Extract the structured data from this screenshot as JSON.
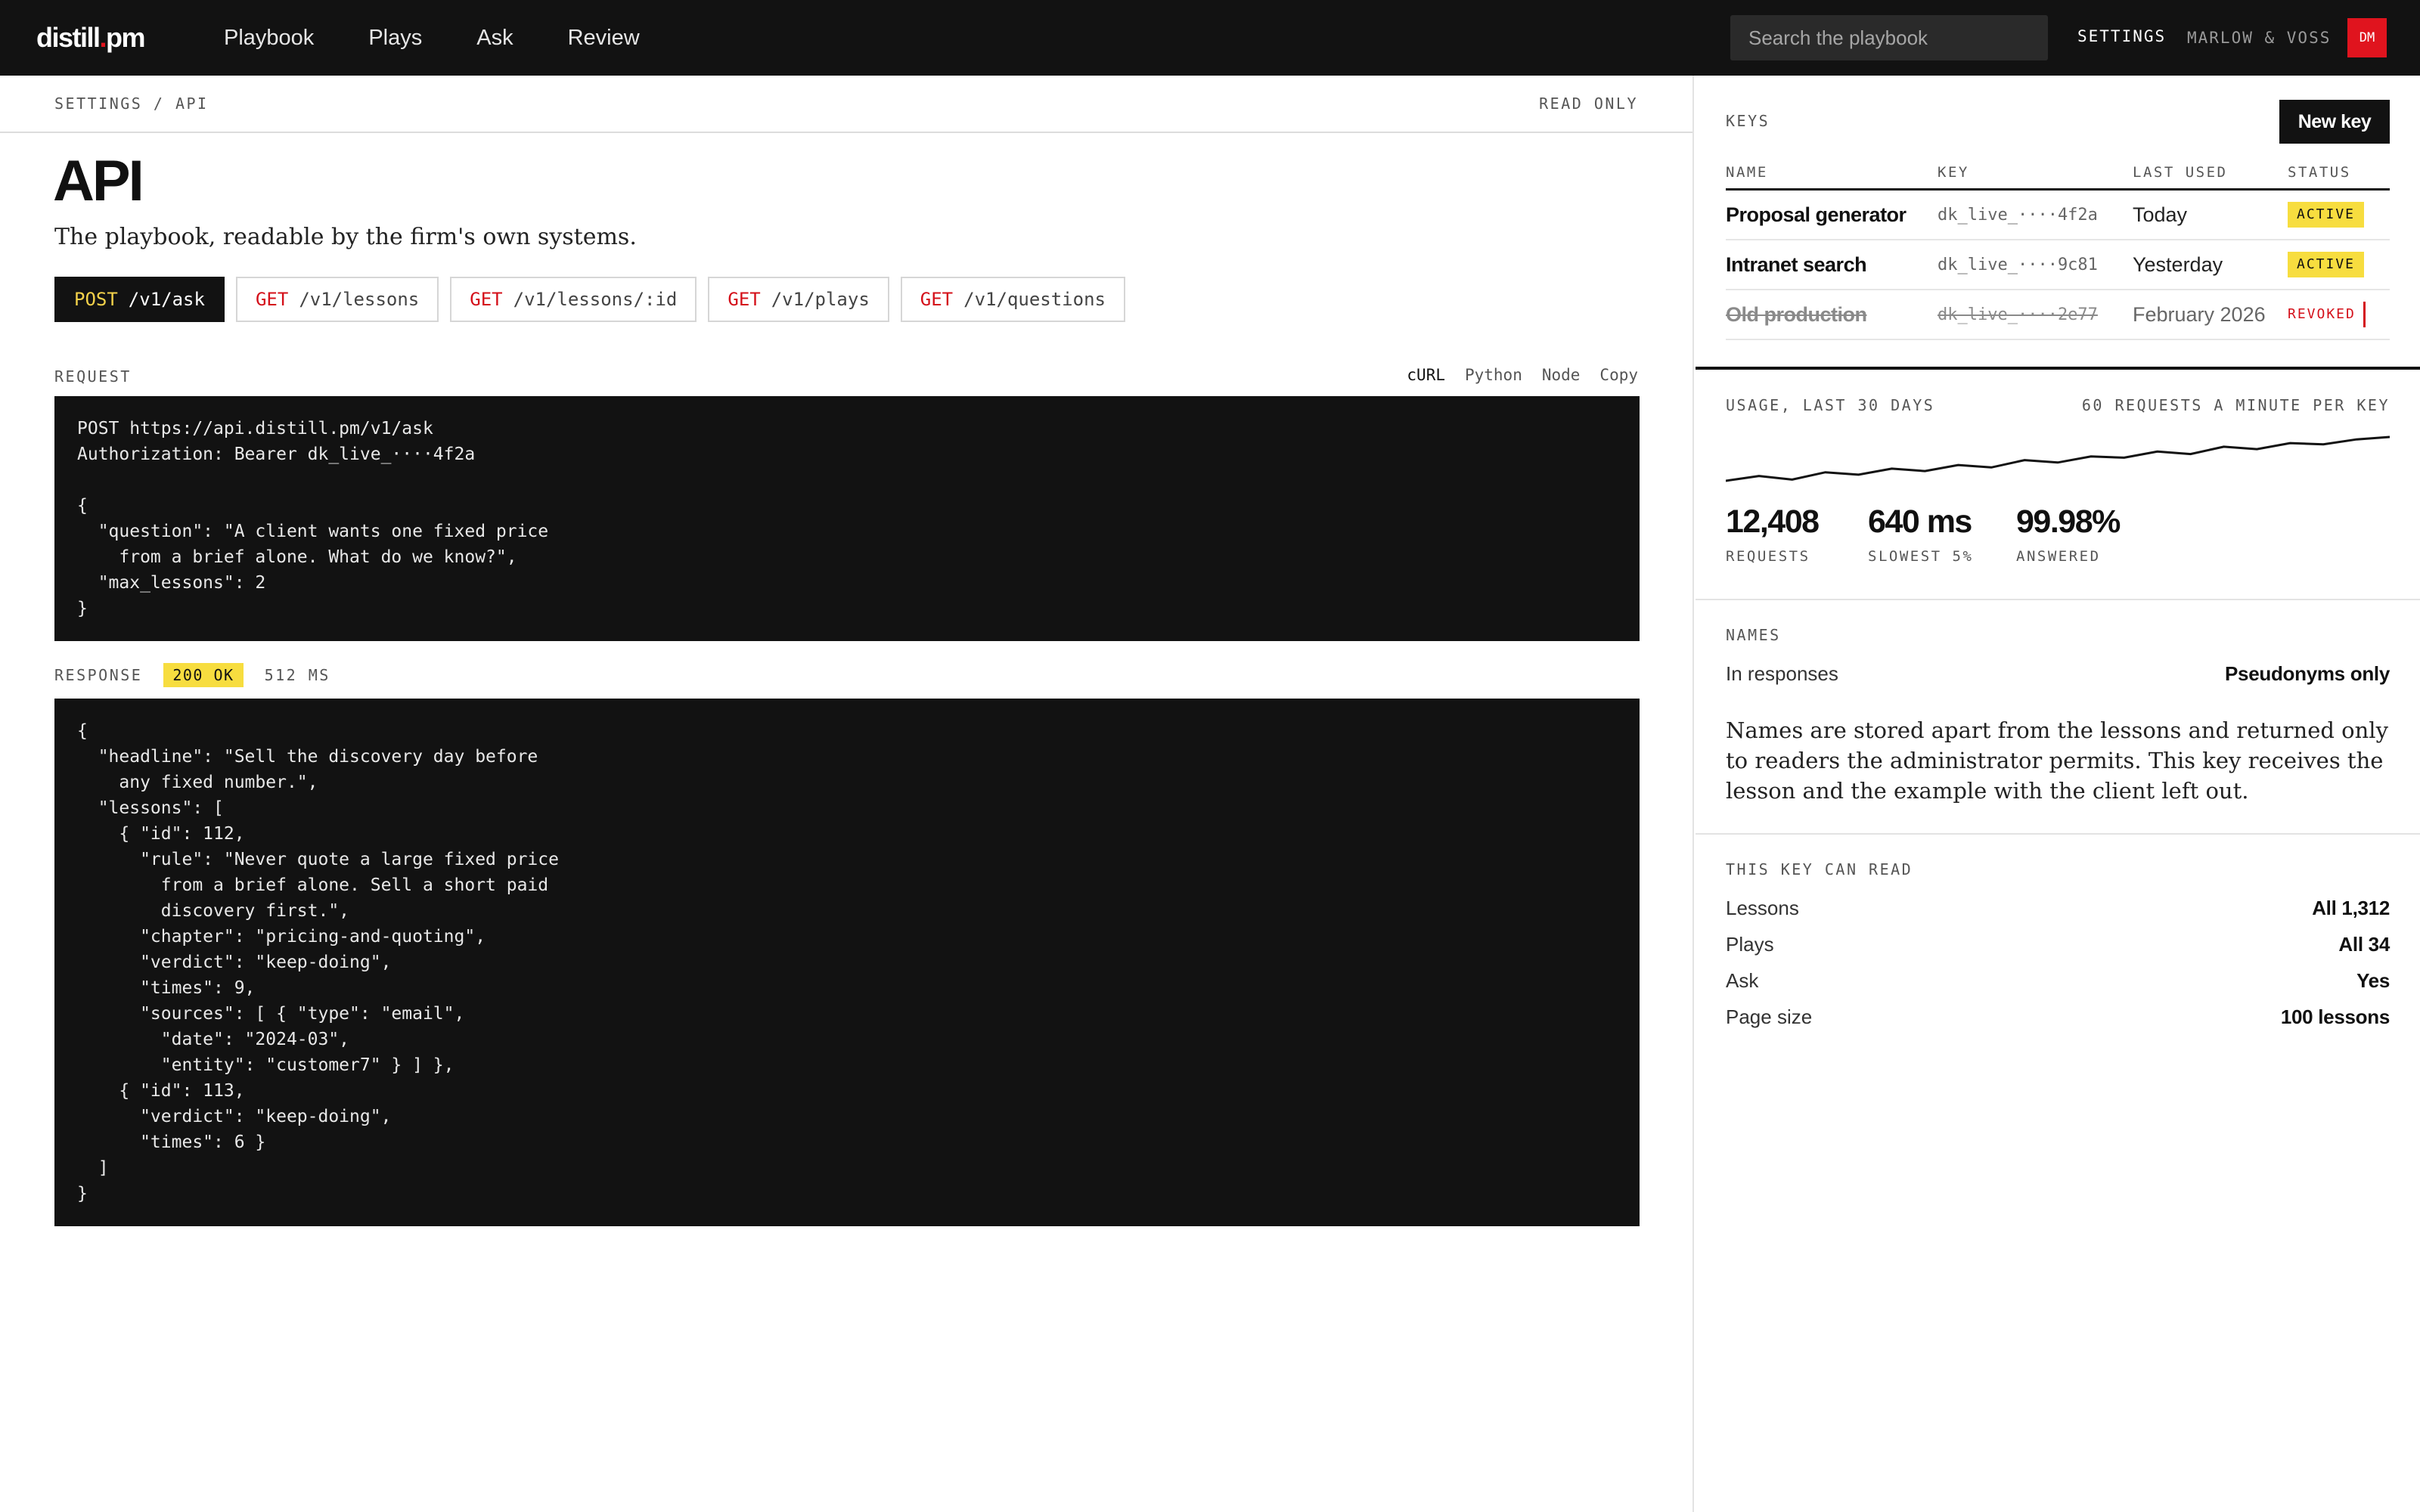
{
  "app": {
    "logo": "distill.pm",
    "nav": [
      "Playbook",
      "Plays",
      "Ask",
      "Review"
    ],
    "search_placeholder": "Search the playbook",
    "settings_label": "SETTINGS",
    "firm": "MARLOW & VOSS",
    "user_initials": "DM",
    "colors": {
      "accent_red": "#e0141e",
      "highlight_yellow": "#f7dd3f",
      "ink": "#121212"
    }
  },
  "page": {
    "breadcrumb": "SETTINGS / API",
    "mode": "READ ONLY",
    "title": "API",
    "subtitle": "The playbook, readable by the firm's own systems."
  },
  "endpoints": [
    {
      "method": "POST",
      "path": "/v1/ask",
      "selected": true
    },
    {
      "method": "GET",
      "path": "/v1/lessons"
    },
    {
      "method": "GET",
      "path": "/v1/lessons/:id"
    },
    {
      "method": "GET",
      "path": "/v1/plays"
    },
    {
      "method": "GET",
      "path": "/v1/questions"
    }
  ],
  "request": {
    "label": "REQUEST",
    "languages": [
      "cURL",
      "Python",
      "Node"
    ],
    "selected_language": "cURL",
    "copy_label": "Copy",
    "code": "POST https://api.distill.pm/v1/ask\nAuthorization: Bearer dk_live_····4f2a\n\n{\n  \"question\": \"A client wants one fixed price\n    from a brief alone. What do we know?\",\n  \"max_lessons\": 2\n}"
  },
  "response": {
    "label": "RESPONSE",
    "status": "200 OK",
    "time": "512 MS",
    "code": "{\n  \"headline\": \"Sell the discovery day before\n    any fixed number.\",\n  \"lessons\": [\n    { \"id\": 112,\n      \"rule\": \"Never quote a large fixed price\n        from a brief alone. Sell a short paid\n        discovery first.\",\n      \"chapter\": \"pricing-and-quoting\",\n      \"verdict\": \"keep-doing\",\n      \"times\": 9,\n      \"sources\": [ { \"type\": \"email\",\n        \"date\": \"2024-03\",\n        \"entity\": \"customer7\" } ] },\n    { \"id\": 113,\n      \"verdict\": \"keep-doing\",\n      \"times\": 6 }\n  ]\n}"
  },
  "keys": {
    "label": "KEYS",
    "new_key_label": "New key",
    "columns": [
      "NAME",
      "KEY",
      "LAST USED",
      "STATUS"
    ],
    "rows": [
      {
        "name": "Proposal generator",
        "key": "dk_live_····4f2a",
        "last_used": "Today",
        "status": "ACTIVE"
      },
      {
        "name": "Intranet search",
        "key": "dk_live_····9c81",
        "last_used": "Yesterday",
        "status": "ACTIVE"
      },
      {
        "name": "Old production",
        "key": "dk_live_····2e77",
        "last_used": "February 2026",
        "status": "REVOKED"
      }
    ]
  },
  "usage": {
    "label": "USAGE, LAST 30 DAYS",
    "rate_limit": "60 REQUESTS A MINUTE PER KEY",
    "trend": [
      10,
      14,
      11,
      17,
      15,
      20,
      18,
      23,
      21,
      27,
      25,
      30,
      29,
      34,
      32,
      38,
      36,
      41,
      40,
      44,
      46
    ],
    "stats": [
      {
        "value": "12,408",
        "label": "REQUESTS"
      },
      {
        "value": "640 ms",
        "label": "SLOWEST 5%"
      },
      {
        "value": "99.98%",
        "label": "ANSWERED"
      }
    ]
  },
  "names": {
    "label": "NAMES",
    "setting_key": "In responses",
    "setting_value": "Pseudonyms only",
    "description": "Names are stored apart from the lessons and returned only to readers the administrator permits. This key receives the lesson and the example with the client left out."
  },
  "scope": {
    "label": "THIS KEY CAN READ",
    "items": [
      {
        "key": "Lessons",
        "value": "All 1,312"
      },
      {
        "key": "Plays",
        "value": "All 34"
      },
      {
        "key": "Ask",
        "value": "Yes"
      },
      {
        "key": "Page size",
        "value": "100 lessons"
      }
    ]
  }
}
